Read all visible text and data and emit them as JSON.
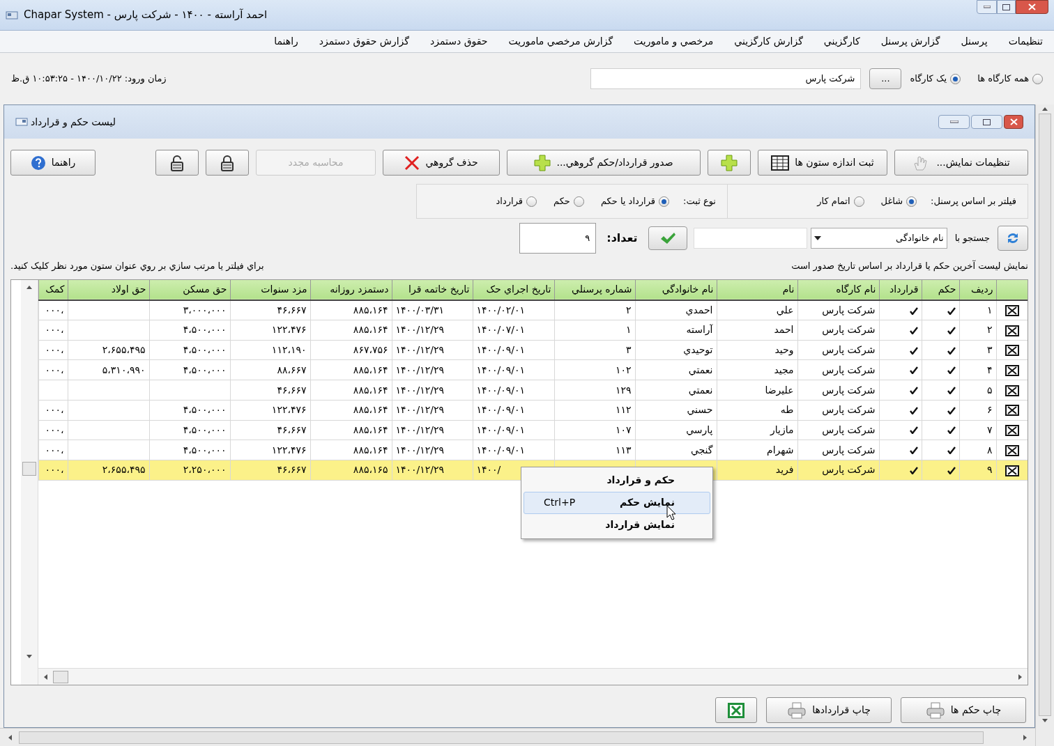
{
  "window": {
    "title": "احمد آراسته - ۱۴۰۰ - شرکت پارس - Chapar System"
  },
  "menu": [
    "تنظیمات",
    "پرسنل",
    "گزارش پرسنل",
    "کارگزيني",
    "گزارش کارگزيني",
    "مرخصي و ماموريت",
    "گزارش مرخصي ماموريت",
    "حقوق دستمزد",
    "گزارش حقوق دستمزد",
    "راهنما"
  ],
  "workshop": {
    "options": [
      {
        "label": "همه کارگاه ها",
        "selected": false
      },
      {
        "label": "يک کارگاه",
        "selected": true
      }
    ],
    "browse_button": "...",
    "value": "شرکت پارس",
    "login_time": "زمان ورود: ۱۴۰۰/۱۰/۲۲ - ۱۰:۵۳:۲۵ ق.ظ"
  },
  "child_window": {
    "title": "ليست حکم و قرارداد",
    "toolbar": [
      {
        "kind": "display-settings",
        "label": "تنظيمات نمايش...",
        "disabled": false
      },
      {
        "kind": "column-size",
        "label": "ثبت اندازه ستون ها",
        "disabled": false
      },
      {
        "kind": "add",
        "disabled": false
      },
      {
        "kind": "group-issue",
        "label": "صدور قرارداد/حکم گروهي...",
        "disabled": false
      },
      {
        "kind": "group-delete",
        "label": "حذف گروهي",
        "disabled": false
      },
      {
        "kind": "recalc",
        "label": "محاسبه مجدد",
        "disabled": true
      },
      {
        "kind": "lock",
        "disabled": false
      },
      {
        "kind": "unlock",
        "disabled": false
      },
      {
        "kind": "help",
        "label": "راهنما",
        "disabled": false
      }
    ],
    "personnel_filter": {
      "label": "فيلتر بر اساس پرسنل:",
      "options": [
        {
          "label": "شاغل",
          "selected": true
        },
        {
          "label": "اتمام کار",
          "selected": false
        }
      ]
    },
    "record_type": {
      "label": "نوع ثبت:",
      "options": [
        {
          "label": "قرارداد يا حکم",
          "selected": true
        },
        {
          "label": "حکم",
          "selected": false
        },
        {
          "label": "قرارداد",
          "selected": false
        }
      ]
    },
    "search": {
      "label": "جستجو با",
      "field": "نام خانوادگی",
      "count_label": "تعداد:",
      "count": "۹"
    },
    "info_right": "نمايش ليست آخرين حکم يا قرارداد بر اساس تاريخ صدور است",
    "info_left": "براي فيلتر يا مرتب سازي بر روي عنوان ستون مورد نظر کليک کنيد.",
    "table": {
      "columns": [
        "رديف",
        "حکم",
        "قرارداد",
        "نام کارگاه",
        "نام",
        "نام خانوادگي",
        "شماره پرسنلي",
        "تاريخ اجراي حک",
        "تاريخ خاتمه قرا",
        "دستمزد روزانه",
        "مزد سنوات",
        "حق مسکن",
        "حق اولاد",
        "کمک"
      ],
      "rows": [
        {
          "selected": false,
          "hokm": true,
          "contract": true,
          "cells": [
            "۱",
            "",
            "",
            "شرکت پارس",
            "علي",
            "احمدي",
            "۲",
            "۱۴۰۰/۰۲/۰۱",
            "۱۴۰۰/۰۳/۳۱",
            "۸۸۵،۱۶۴",
            "۴۶،۶۶۷",
            "۳،۰۰۰،۰۰۰",
            "",
            "،۰۰۰"
          ]
        },
        {
          "selected": false,
          "hokm": true,
          "contract": true,
          "cells": [
            "۲",
            "",
            "",
            "شرکت پارس",
            "احمد",
            "آراسته",
            "۱",
            "۱۴۰۰/۰۷/۰۱",
            "۱۴۰۰/۱۲/۲۹",
            "۸۸۵،۱۶۴",
            "۱۲۲،۴۷۶",
            "۴،۵۰۰،۰۰۰",
            "",
            "،۰۰۰"
          ]
        },
        {
          "selected": false,
          "hokm": true,
          "contract": true,
          "cells": [
            "۳",
            "",
            "",
            "شرکت پارس",
            "وحيد",
            "توحيدي",
            "۳",
            "۱۴۰۰/۰۹/۰۱",
            "۱۴۰۰/۱۲/۲۹",
            "۸۶۷،۷۵۶",
            "۱۱۲،۱۹۰",
            "۴،۵۰۰،۰۰۰",
            "۲،۶۵۵،۴۹۵",
            "،۰۰۰"
          ]
        },
        {
          "selected": false,
          "hokm": true,
          "contract": true,
          "cells": [
            "۴",
            "",
            "",
            "شرکت پارس",
            "مجيد",
            "نعمتي",
            "۱۰۲",
            "۱۴۰۰/۰۹/۰۱",
            "۱۴۰۰/۱۲/۲۹",
            "۸۸۵،۱۶۴",
            "۸۸،۶۶۷",
            "۴،۵۰۰،۰۰۰",
            "۵،۳۱۰،۹۹۰",
            "،۰۰۰"
          ]
        },
        {
          "selected": false,
          "hokm": true,
          "contract": true,
          "cells": [
            "۵",
            "",
            "",
            "شرکت پارس",
            "عليرضا",
            "نعمتي",
            "۱۲۹",
            "۱۴۰۰/۰۹/۰۱",
            "۱۴۰۰/۱۲/۲۹",
            "۸۸۵،۱۶۴",
            "۴۶،۶۶۷",
            "",
            "",
            ""
          ]
        },
        {
          "selected": false,
          "hokm": true,
          "contract": true,
          "cells": [
            "۶",
            "",
            "",
            "شرکت پارس",
            "طه",
            "حسني",
            "۱۱۲",
            "۱۴۰۰/۰۹/۰۱",
            "۱۴۰۰/۱۲/۲۹",
            "۸۸۵،۱۶۴",
            "۱۲۲،۴۷۶",
            "۴،۵۰۰،۰۰۰",
            "",
            "،۰۰۰"
          ]
        },
        {
          "selected": false,
          "hokm": true,
          "contract": true,
          "cells": [
            "۷",
            "",
            "",
            "شرکت پارس",
            "مازيار",
            "پارسي",
            "۱۰۷",
            "۱۴۰۰/۰۹/۰۱",
            "۱۴۰۰/۱۲/۲۹",
            "۸۸۵،۱۶۴",
            "۴۶،۶۶۷",
            "۴،۵۰۰،۰۰۰",
            "",
            "،۰۰۰"
          ]
        },
        {
          "selected": false,
          "hokm": true,
          "contract": true,
          "cells": [
            "۸",
            "",
            "",
            "شرکت پارس",
            "شهرام",
            "گنجي",
            "۱۱۳",
            "۱۴۰۰/۰۹/۰۱",
            "۱۴۰۰/۱۲/۲۹",
            "۸۸۵،۱۶۴",
            "۱۲۲،۴۷۶",
            "۴،۵۰۰،۰۰۰",
            "",
            "،۰۰۰"
          ]
        },
        {
          "selected": true,
          "hokm": true,
          "contract": true,
          "cells": [
            "۹",
            "",
            "",
            "شرکت پارس",
            "فريد",
            "",
            "",
            "۱۴۰۰/",
            "۱۴۰۰/۱۲/۲۹",
            "۸۸۵،۱۶۵",
            "۴۶،۶۶۷",
            "۲،۲۵۰،۰۰۰",
            "۲،۶۵۵،۴۹۵",
            "،۰۰۰"
          ]
        }
      ]
    },
    "context_menu": [
      {
        "label": "حکم و قرارداد",
        "selected": false
      },
      {
        "label": "نمايش حکم",
        "shortcut": "Ctrl+P",
        "selected": true
      },
      {
        "label": "نمايش قرارداد",
        "selected": false
      }
    ],
    "bottom_buttons": [
      {
        "kind": "print",
        "label": "چاپ حکم ها"
      },
      {
        "kind": "print",
        "label": "چاپ قراردادها"
      },
      {
        "kind": "excel"
      }
    ]
  }
}
